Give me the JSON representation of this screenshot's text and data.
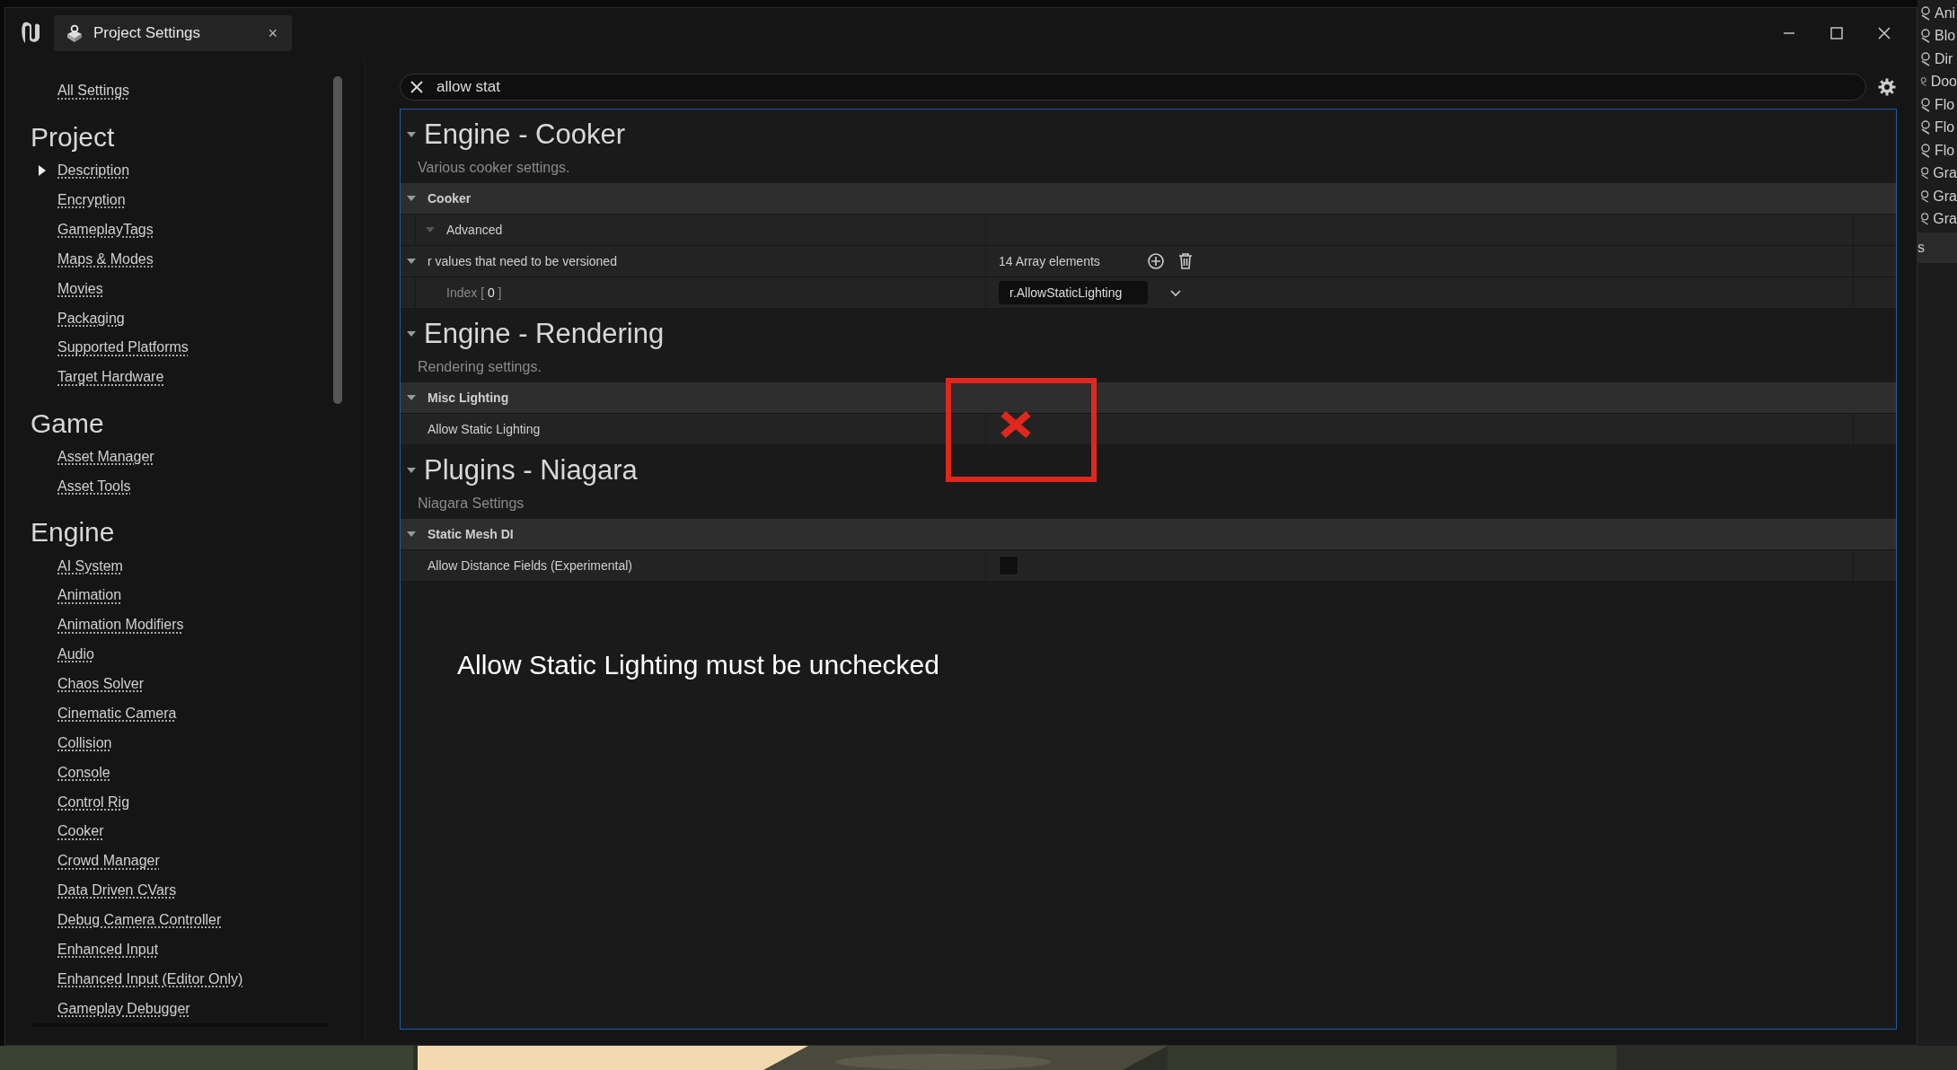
{
  "window": {
    "tab_title": "Project Settings",
    "tab_close": "×"
  },
  "sidebar": {
    "all_settings": "All Settings",
    "sections": [
      {
        "title": "Project",
        "items": [
          {
            "label": "Description",
            "expandable": true
          },
          {
            "label": "Encryption",
            "expandable": false
          },
          {
            "label": "GameplayTags",
            "expandable": false
          },
          {
            "label": "Maps & Modes",
            "expandable": false
          },
          {
            "label": "Movies",
            "expandable": false
          },
          {
            "label": "Packaging",
            "expandable": false
          },
          {
            "label": "Supported Platforms",
            "expandable": false
          },
          {
            "label": "Target Hardware",
            "expandable": false
          }
        ]
      },
      {
        "title": "Game",
        "items": [
          {
            "label": "Asset Manager",
            "expandable": false
          },
          {
            "label": "Asset Tools",
            "expandable": false
          }
        ]
      },
      {
        "title": "Engine",
        "items": [
          {
            "label": "AI System",
            "expandable": false
          },
          {
            "label": "Animation",
            "expandable": false
          },
          {
            "label": "Animation Modifiers",
            "expandable": false
          },
          {
            "label": "Audio",
            "expandable": false
          },
          {
            "label": "Chaos Solver",
            "expandable": false
          },
          {
            "label": "Cinematic Camera",
            "expandable": false
          },
          {
            "label": "Collision",
            "expandable": false
          },
          {
            "label": "Console",
            "expandable": false
          },
          {
            "label": "Control Rig",
            "expandable": false
          },
          {
            "label": "Cooker",
            "expandable": false
          },
          {
            "label": "Crowd Manager",
            "expandable": false
          },
          {
            "label": "Data Driven CVars",
            "expandable": false
          },
          {
            "label": "Debug Camera Controller",
            "expandable": false
          },
          {
            "label": "Enhanced Input",
            "expandable": false
          },
          {
            "label": "Enhanced Input (Editor Only)",
            "expandable": false
          },
          {
            "label": "Gameplay Debugger",
            "expandable": false
          }
        ]
      }
    ]
  },
  "search": {
    "value": "allow stat"
  },
  "categories": [
    {
      "title": "Engine - Cooker",
      "description": "Various cooker settings.",
      "rows": [
        {
          "kind": "group",
          "label": "Cooker"
        },
        {
          "kind": "subgroup",
          "label": "Advanced"
        },
        {
          "kind": "array",
          "label": "r values that need to be versioned",
          "value": "14 Array elements"
        },
        {
          "kind": "array-item",
          "label": "Index [ **0** ]",
          "value": "r.AllowStaticLighting"
        }
      ]
    },
    {
      "title": "Engine - Rendering",
      "description": "Rendering settings.",
      "rows": [
        {
          "kind": "group",
          "label": "Misc Lighting"
        },
        {
          "kind": "checkbox",
          "label": "Allow Static Lighting"
        }
      ]
    },
    {
      "title": "Plugins - Niagara",
      "description": "Niagara Settings",
      "rows": [
        {
          "kind": "group",
          "label": "Static Mesh DI"
        },
        {
          "kind": "checkbox",
          "label": "Allow Distance Fields (Experimental)",
          "checked": false
        }
      ]
    }
  ],
  "annotation": {
    "text": "Allow Static Lighting must be unchecked"
  },
  "background_outliner": {
    "items": [
      "Ani",
      "Blo",
      "Dir",
      "Doo",
      "Flo",
      "Flo",
      "Flo",
      "Gra",
      "Gra",
      "Gra"
    ],
    "footer": "s"
  }
}
